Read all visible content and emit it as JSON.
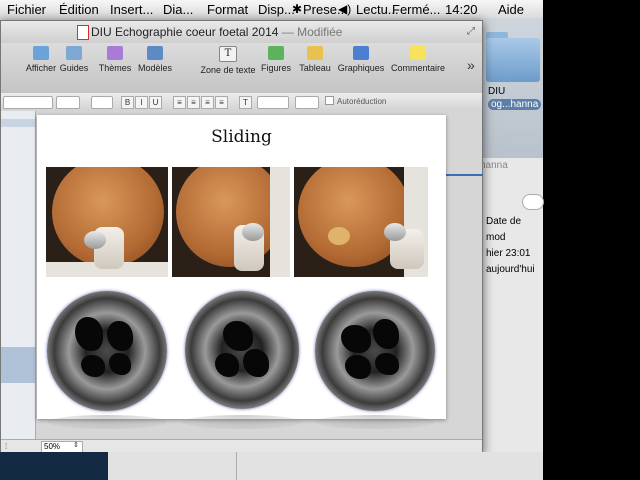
{
  "menubar": {
    "items": [
      "Fichier",
      "Édition",
      "Insert...",
      "Dia...",
      "Format",
      "Disp..."
    ],
    "extras": [
      "Prese...",
      "Lectu...",
      "Fermé...",
      "14:20"
    ],
    "help": "Aide"
  },
  "window": {
    "title": "DIU Echographie coeur foetal 2014",
    "modified": " — Modifiée"
  },
  "toolbar": {
    "items": [
      {
        "label": "Afficher",
        "icon": "view-icon",
        "color": "#6aa3d9"
      },
      {
        "label": "Guides",
        "icon": "guides-icon",
        "color": "#7fa7d4"
      },
      {
        "label": "Thèmes",
        "icon": "themes-icon",
        "color": "#a77bd6"
      },
      {
        "label": "Modèles",
        "icon": "masters-icon",
        "color": "#5f89c4"
      },
      {
        "label": "Zone de texte",
        "icon": "textbox-icon",
        "color": "#f2f2f2"
      },
      {
        "label": "Figures",
        "icon": "shapes-icon",
        "color": "#5bb35b"
      },
      {
        "label": "Tableau",
        "icon": "table-icon",
        "color": "#e9c24d"
      },
      {
        "label": "Graphiques",
        "icon": "charts-icon",
        "color": "#4d7fd0"
      },
      {
        "label": "Commentaire",
        "icon": "comment-icon",
        "color": "#f5e35a"
      }
    ]
  },
  "formatbar": {
    "bold": "B",
    "italic": "I",
    "underline": "U",
    "autoreduction": "Autoréduction"
  },
  "slide": {
    "title": "Sliding"
  },
  "statusbar": {
    "zoom": "50%"
  },
  "finder": {
    "folder_name": "DIU",
    "folder_sub": "og...hanna",
    "side_label": "hanna",
    "column_header": "Date de mod",
    "dates": [
      "hier 23:01",
      "aujourd'hui"
    ]
  }
}
